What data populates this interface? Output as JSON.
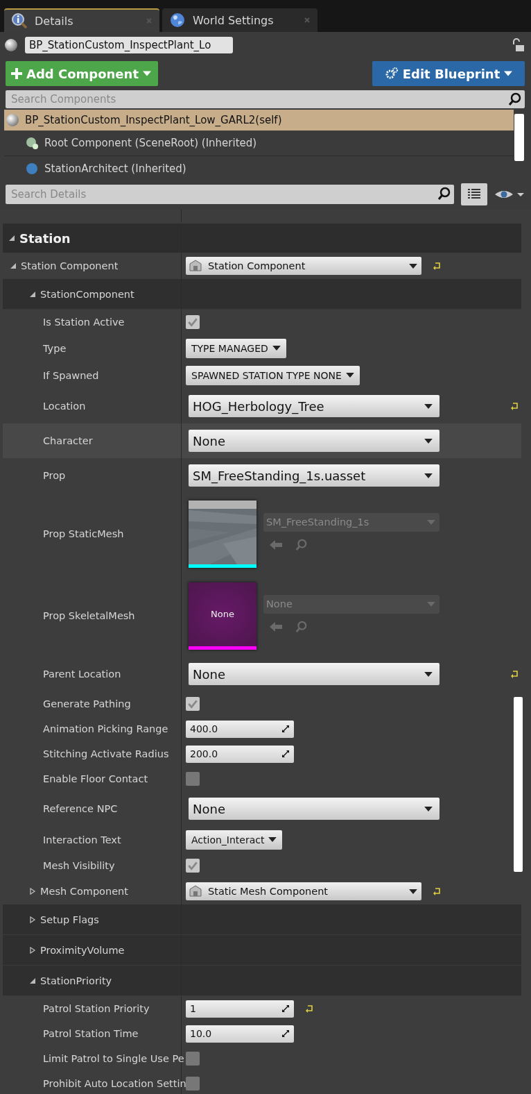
{
  "tabs": [
    {
      "label": "Details",
      "selected": true
    },
    {
      "label": "World Settings",
      "selected": false
    }
  ],
  "object_name": "BP_StationCustom_InspectPlant_Lo",
  "add_component_button": "Add Component",
  "edit_blueprint_button": "Edit Blueprint",
  "component_search": {
    "placeholder": "Search Components"
  },
  "components": [
    {
      "label": "BP_StationCustom_InspectPlant_Low_GARL2(self)",
      "selected": true
    },
    {
      "label": "Root Component (SceneRoot) (Inherited)",
      "selected": false
    },
    {
      "label": "StationArchitect (Inherited)",
      "selected": false
    }
  ],
  "details_search": {
    "placeholder": "Search Details"
  },
  "properties": [
    {
      "kind": "category",
      "label": "Station",
      "expanded": true,
      "children": [
        {
          "kind": "component",
          "label": "Station Component",
          "value": "Station Component",
          "expanded": true,
          "reset": true,
          "children": [
            {
              "kind": "subcategory",
              "label": "StationComponent",
              "expanded": true,
              "children": [
                {
                  "kind": "checkbox",
                  "label": "Is Station Active",
                  "checked": true
                },
                {
                  "kind": "combo",
                  "label": "Type",
                  "value": "TYPE MANAGED"
                },
                {
                  "kind": "combo",
                  "label": "If Spawned",
                  "value": "SPAWNED STATION TYPE NONE"
                },
                {
                  "kind": "dropdown",
                  "label": "Location",
                  "value": "HOG_Herbology_Tree",
                  "reset": true
                },
                {
                  "kind": "dropdown",
                  "label": "Character",
                  "value": "None",
                  "hovered": true
                },
                {
                  "kind": "dropdown",
                  "label": "Prop",
                  "value": "SM_FreeStanding_1s.uasset"
                },
                {
                  "kind": "asset",
                  "label": "Prop StaticMesh",
                  "value": "SM_FreeStanding_1s",
                  "color": "#00ffff"
                },
                {
                  "kind": "asset",
                  "label": "Prop SkeletalMesh",
                  "value": "None",
                  "thumbnail": {
                    "kind": "empty",
                    "text": "None"
                  },
                  "color": "#ff00ff"
                },
                {
                  "kind": "dropdown",
                  "label": "Parent Location",
                  "value": "None",
                  "reset": true
                },
                {
                  "kind": "checkbox",
                  "label": "Generate Pathing",
                  "checked": true
                },
                {
                  "kind": "number",
                  "label": "Animation Picking Range",
                  "value": "400.0"
                },
                {
                  "kind": "number",
                  "label": "Stitching Activate Radius",
                  "value": "200.0"
                },
                {
                  "kind": "checkbox",
                  "label": "Enable Floor Contact",
                  "checked": false
                },
                {
                  "kind": "dropdown",
                  "label": "Reference NPC",
                  "value": "None"
                },
                {
                  "kind": "combo",
                  "label": "Interaction Text",
                  "value": "Action_Interact"
                },
                {
                  "kind": "checkbox",
                  "label": "Mesh Visibility",
                  "checked": true
                },
                {
                  "kind": "component",
                  "label": "Mesh Component",
                  "value": "Static Mesh Component",
                  "expanded": false,
                  "reset": true
                }
              ]
            },
            {
              "kind": "subcategory",
              "label": "Setup Flags",
              "expanded": false
            },
            {
              "kind": "subcategory",
              "label": "ProximityVolume",
              "expanded": false
            },
            {
              "kind": "subcategory",
              "label": "StationPriority",
              "expanded": true,
              "children": [
                {
                  "kind": "number",
                  "label": "Patrol Station Priority",
                  "value": "1",
                  "reset": true
                },
                {
                  "kind": "number",
                  "label": "Patrol Station Time",
                  "value": "10.0"
                },
                {
                  "kind": "checkbox",
                  "label": "Limit Patrol to Single Use Pe",
                  "checked": false
                },
                {
                  "kind": "checkbox",
                  "label": "Prohibit Auto Location Settin",
                  "checked": false
                }
              ]
            }
          ]
        }
      ]
    }
  ]
}
